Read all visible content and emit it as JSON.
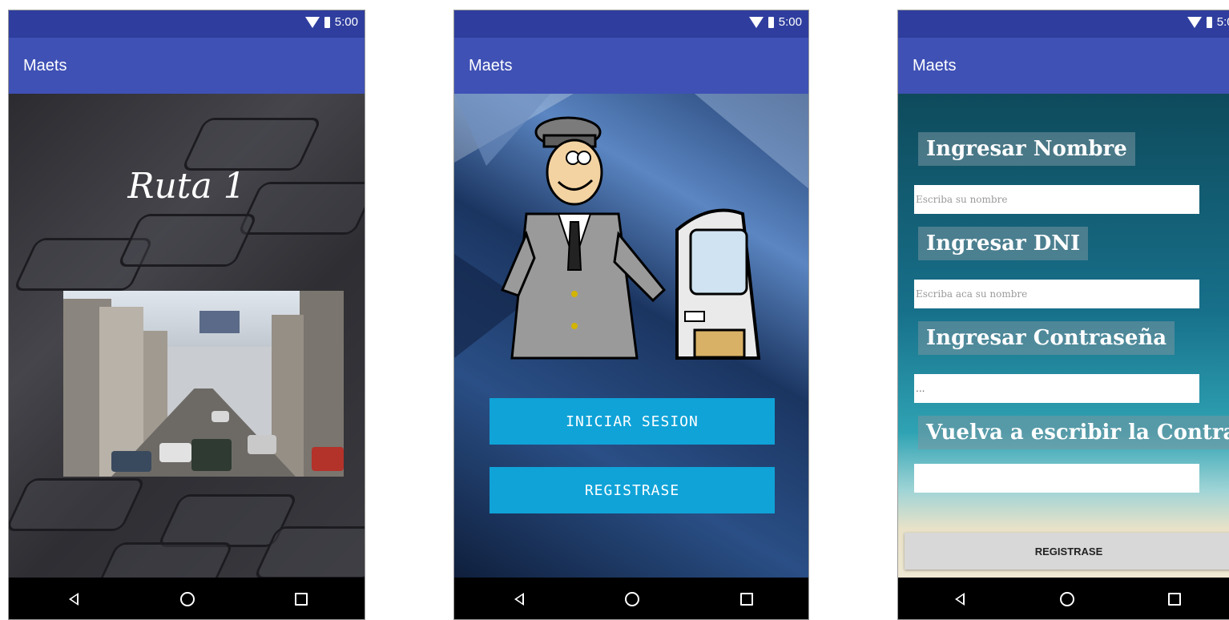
{
  "status": {
    "time": "5:00"
  },
  "screens": [
    {
      "app_title": "Maets",
      "splash_title": "Ruta 1"
    },
    {
      "app_title": "Maets",
      "login_button": "INICIAR SESION",
      "register_button": "REGISTRASE"
    },
    {
      "app_title": "Maets",
      "name_label": "Ingresar Nombre",
      "name_placeholder": "Escriba su nombre",
      "dni_label": "Ingresar DNI",
      "dni_placeholder": "Escriba aca su nombre",
      "password_label": "Ingresar Contraseña",
      "password_value": "...",
      "repeat_password_label": "Vuelva a escribir la Contraseña",
      "repeat_password_value": "",
      "register_button": "REGISTRASE"
    }
  ],
  "colors": {
    "appbar": "#3f51b5",
    "statusbar": "#2f3e9e",
    "login_button": "#0fa3d8"
  },
  "icons": [
    "wifi-icon",
    "battery-icon",
    "back-icon",
    "home-icon",
    "recents-icon"
  ]
}
